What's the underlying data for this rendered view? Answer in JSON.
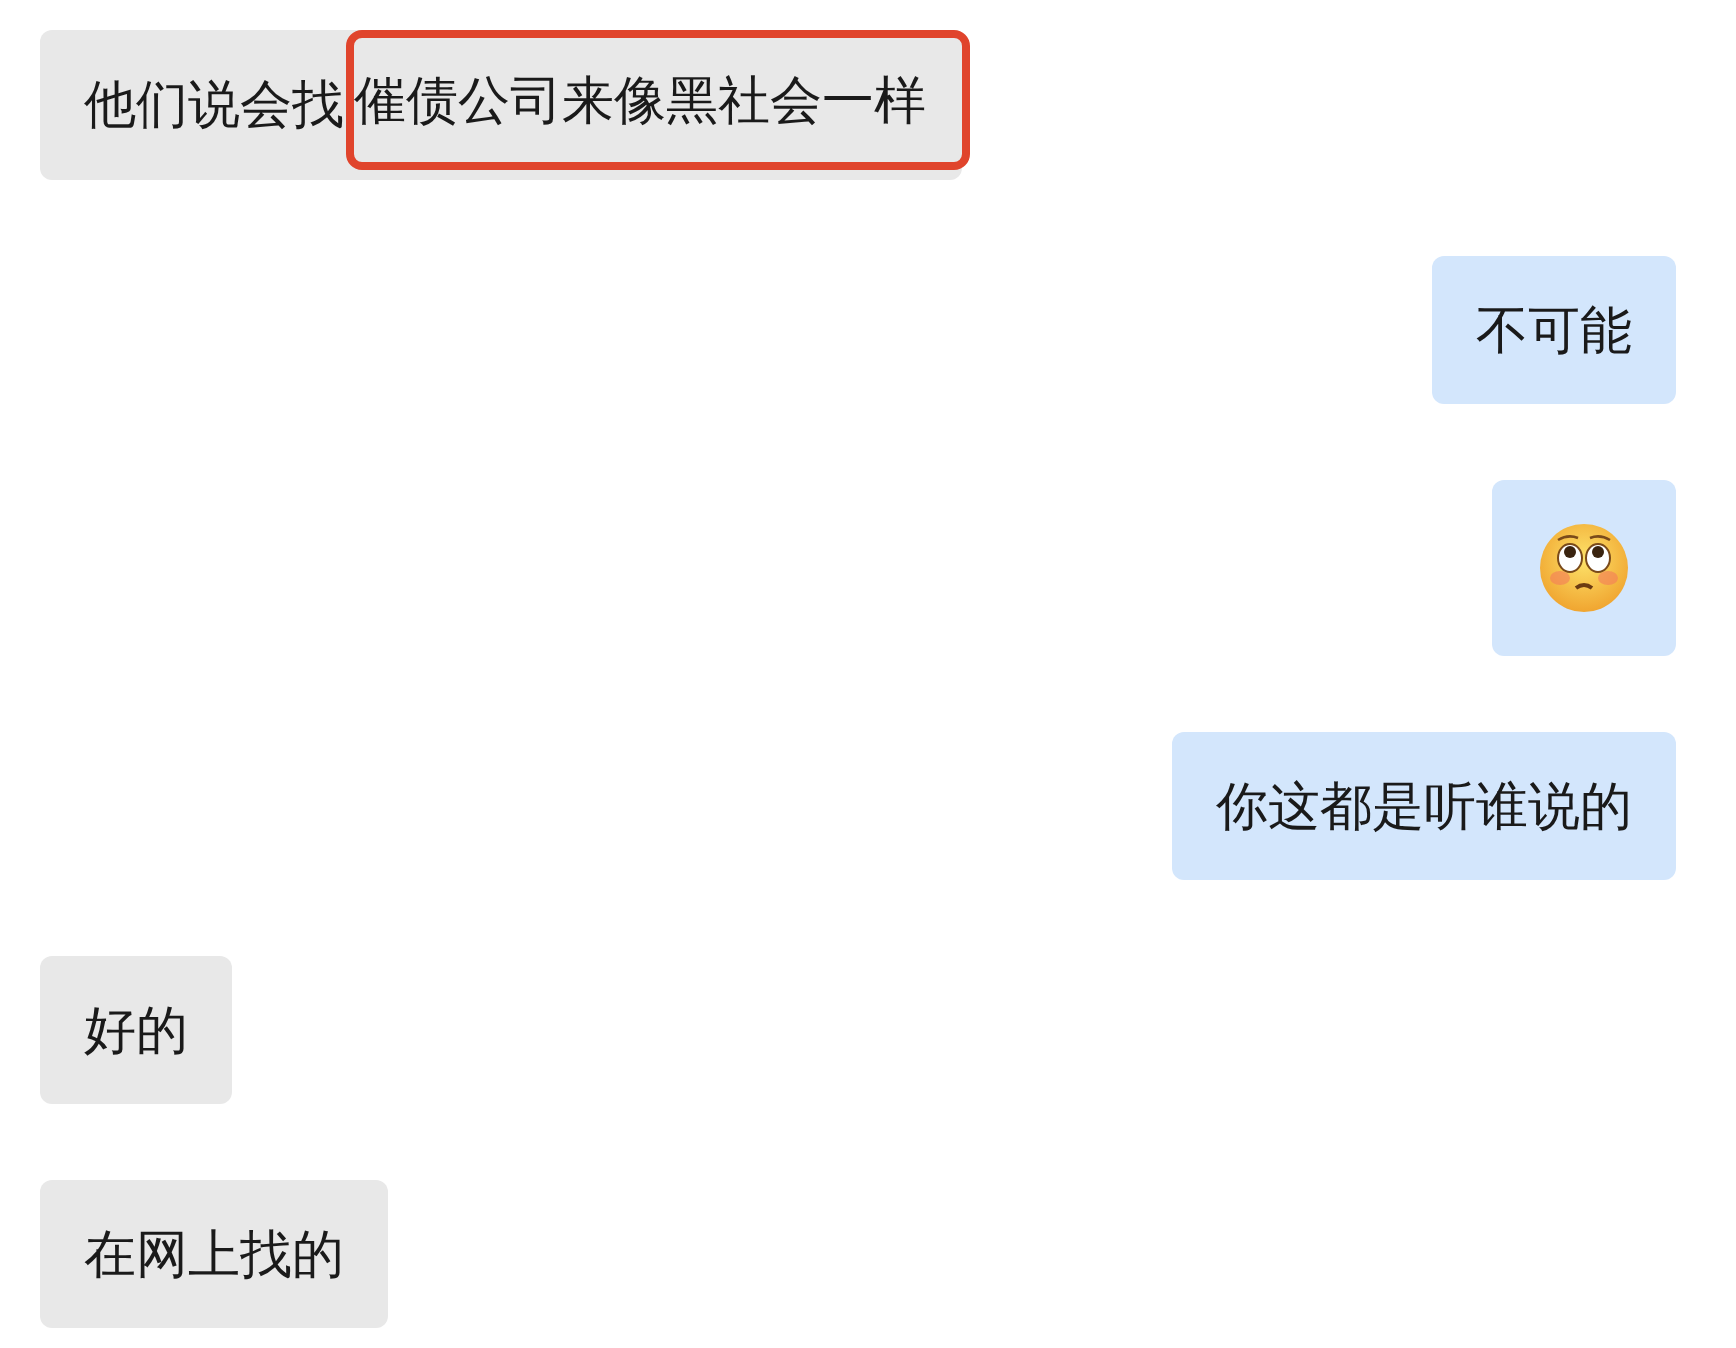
{
  "messages": [
    {
      "outgoing": false,
      "kind": "text",
      "text": "他们说会找",
      "highlighted": "催债公司来像黑社会一样"
    },
    {
      "outgoing": true,
      "kind": "text",
      "text": "不可能"
    },
    {
      "outgoing": true,
      "kind": "emoji"
    },
    {
      "outgoing": true,
      "kind": "text",
      "text": "你这都是听谁说的"
    },
    {
      "outgoing": false,
      "kind": "text",
      "text": "好的"
    },
    {
      "outgoing": false,
      "kind": "text",
      "text": "在网上找的"
    }
  ]
}
